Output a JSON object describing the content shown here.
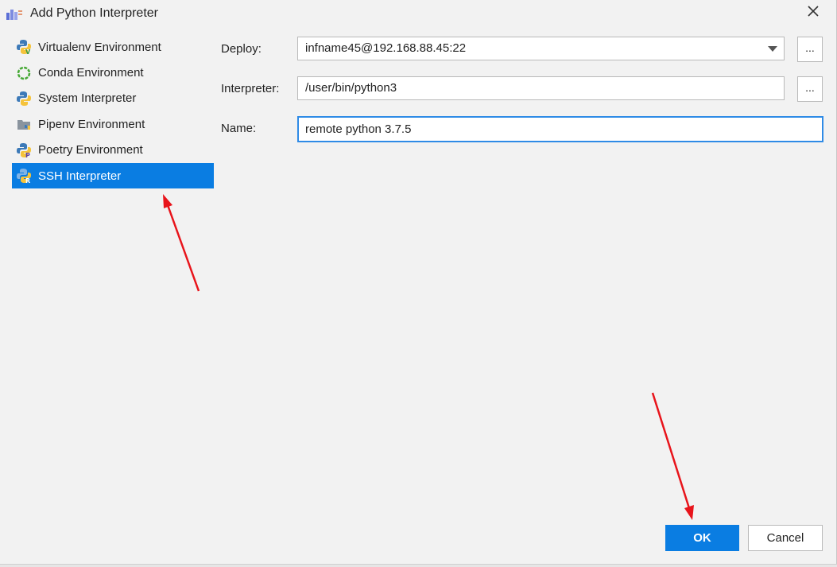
{
  "window": {
    "title": "Add Python Interpreter"
  },
  "sidebar": {
    "items": [
      {
        "label": "Virtualenv Environment",
        "icon": "python-virtualenv-icon",
        "selected": false
      },
      {
        "label": "Conda Environment",
        "icon": "conda-icon",
        "selected": false
      },
      {
        "label": "System Interpreter",
        "icon": "python-icon",
        "selected": false
      },
      {
        "label": "Pipenv Environment",
        "icon": "pipenv-icon",
        "selected": false
      },
      {
        "label": "Poetry Environment",
        "icon": "python-poetry-icon",
        "selected": false
      },
      {
        "label": "SSH Interpreter",
        "icon": "python-remote-icon",
        "selected": true
      }
    ]
  },
  "form": {
    "deploy": {
      "label": "Deploy:",
      "value": "infname45@192.168.88.45:22",
      "browse": "..."
    },
    "interpreter": {
      "label": "Interpreter:",
      "value": "/user/bin/python3",
      "browse": "..."
    },
    "name": {
      "label": "Name:",
      "value": "remote python 3.7.5"
    }
  },
  "footer": {
    "ok_label": "OK",
    "cancel_label": "Cancel"
  },
  "colors": {
    "accent": "#0a7de2",
    "focus": "#2f8be6",
    "annotation_arrow": "#e8141b"
  }
}
